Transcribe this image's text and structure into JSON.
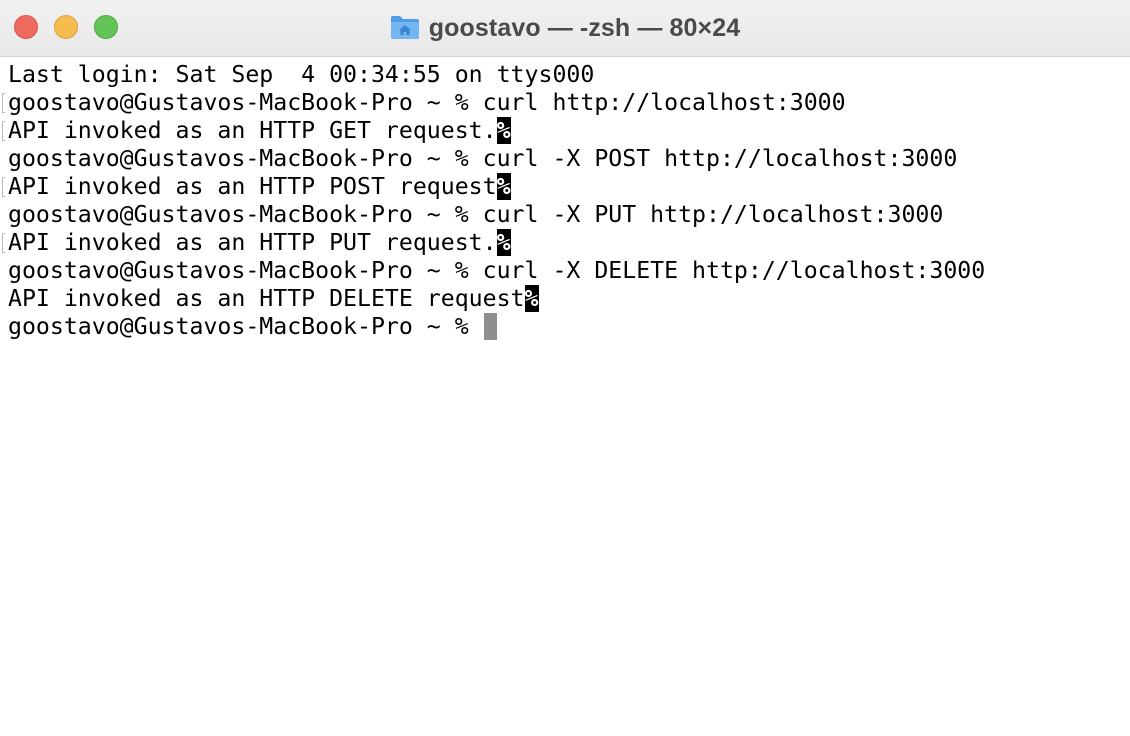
{
  "window": {
    "title": "goostavo — -zsh — 80×24",
    "folder_icon": "home-folder-icon",
    "traffic_lights": {
      "close": "#ee6a5e",
      "minimize": "#f5bd4f",
      "maximize": "#61c454"
    }
  },
  "terminal": {
    "lines": [
      {
        "text": "Last login: Sat Sep  4 00:34:55 on ttys000"
      },
      {
        "text": "goostavo@Gustavos-MacBook-Pro ~ % curl http://localhost:3000"
      },
      {
        "text": "API invoked as an HTTP GET request.",
        "end_marker": "%"
      },
      {
        "text": "goostavo@Gustavos-MacBook-Pro ~ % curl -X POST http://localhost:3000"
      },
      {
        "text": "API invoked as an HTTP POST request",
        "end_marker": "%"
      },
      {
        "text": "goostavo@Gustavos-MacBook-Pro ~ % curl -X PUT http://localhost:3000"
      },
      {
        "text": "API invoked as an HTTP PUT request.",
        "end_marker": "%"
      },
      {
        "text": "goostavo@Gustavos-MacBook-Pro ~ % curl -X DELETE http://localhost:3000"
      },
      {
        "text": "API invoked as an HTTP DELETE request",
        "end_marker": "%"
      },
      {
        "text": "goostavo@Gustavos-MacBook-Pro ~ % "
      }
    ]
  }
}
